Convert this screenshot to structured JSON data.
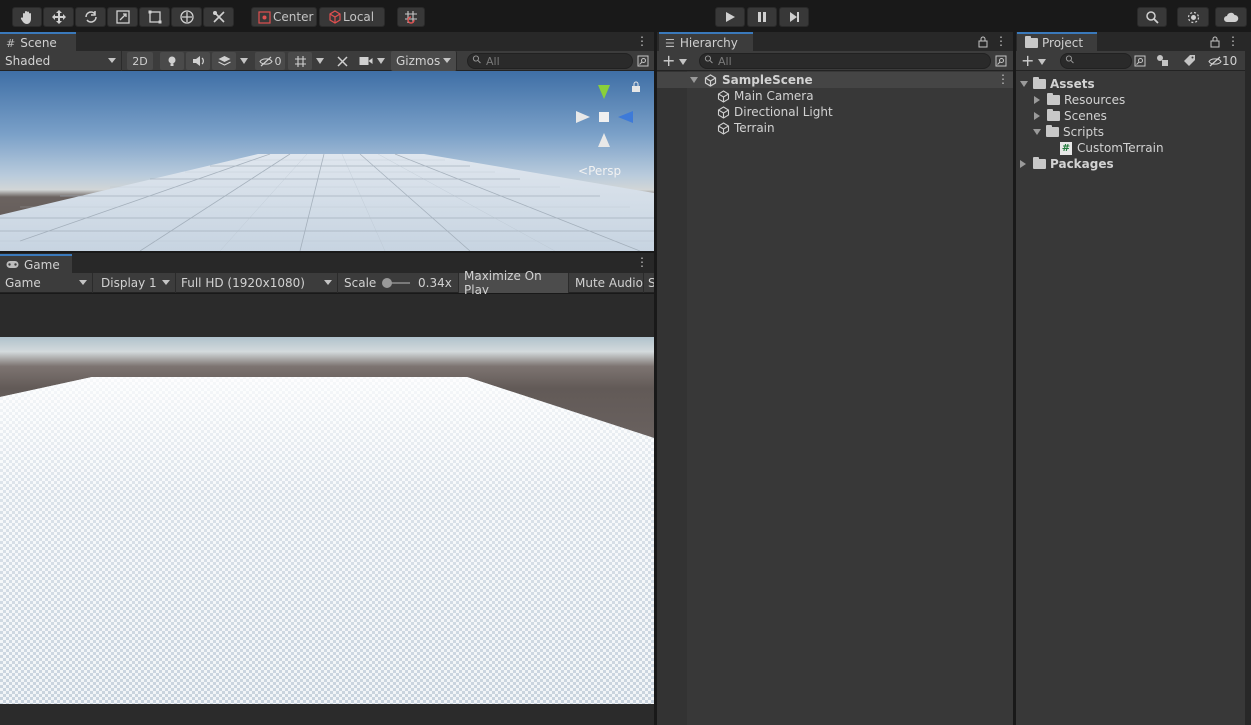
{
  "toolbar": {
    "center_label": "Center",
    "local_label": "Local"
  },
  "scene": {
    "tab_label": "Scene",
    "shading_mode": "Shaded",
    "mode_2d": "2D",
    "hidden_count": "0",
    "gizmos_label": "Gizmos",
    "search_placeholder": "All",
    "projection_label": "Persp"
  },
  "game": {
    "tab_label": "Game",
    "view_dropdown": "Game",
    "display_dropdown": "Display 1",
    "resolution_dropdown": "Full HD (1920x1080)",
    "scale_label": "Scale",
    "scale_value": "0.34x",
    "maximize_label": "Maximize On Play",
    "mute_label": "Mute Audio",
    "stats_label": "S"
  },
  "hierarchy": {
    "tab_label": "Hierarchy",
    "search_placeholder": "All",
    "scene_name": "SampleScene",
    "items": [
      "Main Camera",
      "Directional Light",
      "Terrain"
    ]
  },
  "project": {
    "tab_label": "Project",
    "hidden_count": "10",
    "assets_label": "Assets",
    "folders": [
      "Resources",
      "Scenes",
      "Scripts"
    ],
    "script_file": "CustomTerrain",
    "packages_label": "Packages"
  },
  "colors": {
    "accent": "#3a79bb",
    "panel_bg": "#383838",
    "toolbar_bg": "#191919"
  }
}
